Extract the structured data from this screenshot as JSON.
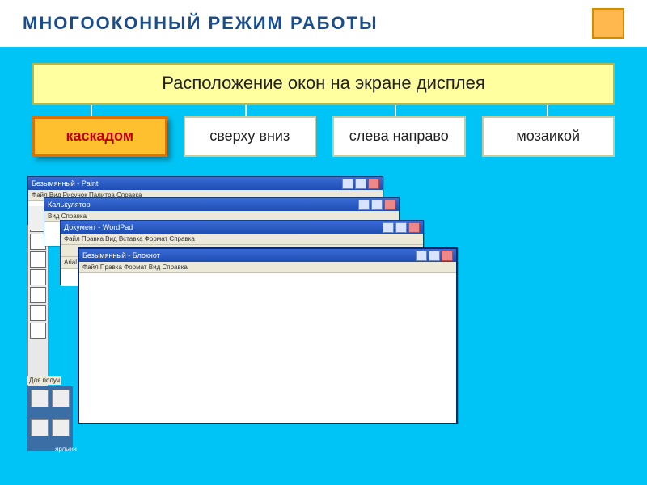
{
  "page_title": "МНОГООКОННЫЙ  РЕЖИМ  РАБОТЫ",
  "header": "Расположение  окон на экране  дисплея",
  "options": {
    "cascade": "каскадом",
    "topdown": "сверху вниз",
    "leftright": "слева направо",
    "mosaic": "мозаикой"
  },
  "windows": {
    "paint": {
      "title": "Безымянный - Paint",
      "menu": "Файл  Вид  Рисунок  Палитра  Справка"
    },
    "calc": {
      "title": "Калькулятор",
      "menu": "Вид  Справка"
    },
    "wordpad": {
      "title": "Документ - WordPad",
      "menu": "Файл  Правка  Вид  Вставка  Формат  Справка",
      "font": "Arial"
    },
    "notepad": {
      "title": "Безымянный - Блокнот",
      "menu": "Файл  Правка  Формат  Вид  Справка"
    }
  },
  "desktop": {
    "label1": "Для получ",
    "label2": "ярлыки"
  }
}
